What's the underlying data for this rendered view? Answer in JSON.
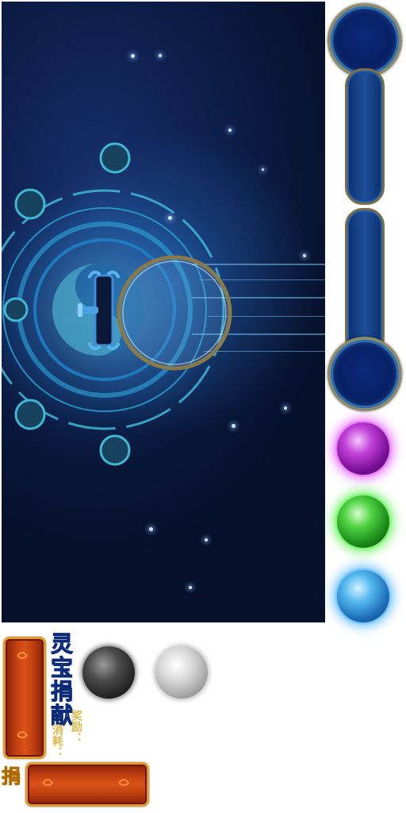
{
  "labels": {
    "title": "灵宝捐献",
    "reward": "奖励：",
    "cost": "消耗：",
    "donate": "捐献"
  },
  "icons": {
    "magic_circle": "magic-rune-circle-icon",
    "portal_ring": "portal-ring-icon",
    "lever": "lever-icon",
    "orbs": [
      "purple-orb-icon",
      "green-orb-icon",
      "blue-orb-icon",
      "dark-ball-icon",
      "light-ball-icon"
    ]
  },
  "colors": {
    "panel_bg": "#0d1f4d",
    "title_blue": "#2f6fd6",
    "label_gold": "#e0b84a",
    "donate_yellow": "#ffd21a",
    "wood_red": "#c4420f",
    "orb_purple": "#c040d8",
    "orb_green": "#4fd242",
    "orb_blue": "#54b8ee"
  }
}
